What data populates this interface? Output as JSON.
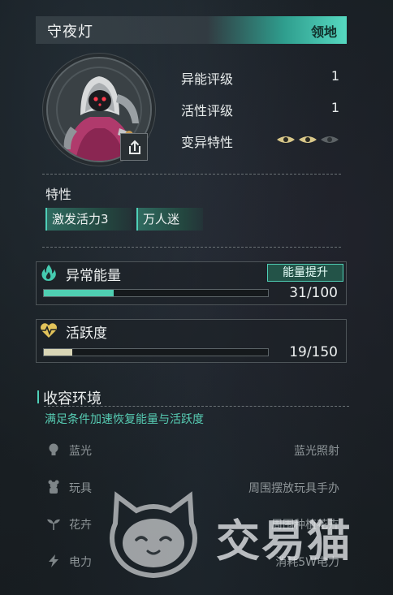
{
  "header": {
    "title": "守夜灯",
    "badge": "领地"
  },
  "stats": [
    {
      "label": "异能评级",
      "value": "1"
    },
    {
      "label": "活性评级",
      "value": "1"
    },
    {
      "label": "变异特性",
      "value": ""
    }
  ],
  "mutation": {
    "active": 2,
    "total": 3
  },
  "traits": {
    "title": "特性",
    "tags": [
      "激发活力3",
      "万人迷"
    ]
  },
  "energy": {
    "label": "异常能量",
    "button": "能量提升",
    "value_text": "31/100",
    "current": 31,
    "max": 100,
    "icon": "flame-icon",
    "bar_color": "#4fcfb2"
  },
  "activity": {
    "label": "活跃度",
    "value_text": "19/150",
    "current": 19,
    "max": 150,
    "icon": "heartbeat-icon",
    "bar_color": "#d9d6b6"
  },
  "environment": {
    "title": "收容环境",
    "subtitle": "满足条件加速恢复能量与活跃度",
    "rows": [
      {
        "icon": "bulb-icon",
        "label": "蓝光",
        "value": "蓝光照射"
      },
      {
        "icon": "toy-icon",
        "label": "玩具",
        "value": "周围摆放玩具手办"
      },
      {
        "icon": "plant-icon",
        "label": "花卉",
        "value": "周围种植花卉"
      },
      {
        "icon": "lightning-icon",
        "label": "电力",
        "value": "消耗5W电力"
      }
    ]
  },
  "watermark": {
    "text": "交易猫"
  },
  "colors": {
    "accent": "#4fd0b8",
    "header_accent": "#56d9c1"
  }
}
